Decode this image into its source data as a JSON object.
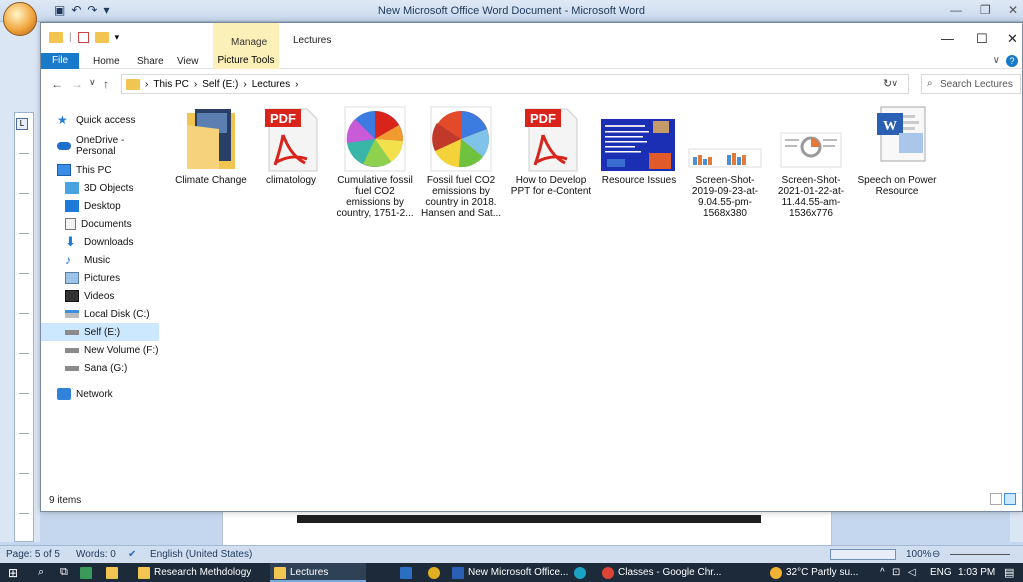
{
  "word": {
    "title": "New Microsoft Office Word Document - Microsoft Word",
    "status": {
      "page": "Page: 5 of 5",
      "words": "Words: 0",
      "language": "English (United States)",
      "zoom": "100%"
    }
  },
  "explorer": {
    "context_tab_group": "Manage",
    "context_title": "Lectures",
    "tabs": [
      "File",
      "Home",
      "Share",
      "View",
      "Picture Tools"
    ],
    "breadcrumb": [
      "This PC",
      "Self (E:)",
      "Lectures"
    ],
    "search_placeholder": "Search Lectures",
    "nav": {
      "quick_access": "Quick access",
      "onedrive": "OneDrive - Personal",
      "this_pc": "This PC",
      "objects3d": "3D Objects",
      "desktop": "Desktop",
      "documents": "Documents",
      "downloads": "Downloads",
      "music": "Music",
      "pictures": "Pictures",
      "videos": "Videos",
      "disk_c": "Local Disk (C:)",
      "self_e": "Self (E:)",
      "volume_f": "New Volume (F:)",
      "sana_g": "Sana (G:)",
      "network": "Network"
    },
    "files": [
      {
        "name": "Climate Change",
        "kind": "folder-icon"
      },
      {
        "name": "climatology",
        "kind": "pdf-icon"
      },
      {
        "name": "Cumulative fossil fuel CO2 emissions by country, 1751-2...",
        "kind": "pie-image-thumbnail"
      },
      {
        "name": "Fossil fuel CO2 emissions by country in 2018. Hansen and Sat...",
        "kind": "pie-image-thumbnail"
      },
      {
        "name": "How to Develop PPT for e-Content",
        "kind": "pdf-icon"
      },
      {
        "name": "Resource Issues",
        "kind": "slide-image-thumbnail"
      },
      {
        "name": "Screen-Shot-2019-09-23-at-9.04.55-pm-1568x380",
        "kind": "screenshot-thumbnail"
      },
      {
        "name": "Screen-Shot-2021-01-22-at-11.44.55-am-1536x776",
        "kind": "screenshot-thumbnail"
      },
      {
        "name": "Speech on Power Resource",
        "kind": "word-document-icon"
      }
    ],
    "pdf_label": "PDF",
    "status": "9 items"
  },
  "taskbar": {
    "items": [
      "Research Methdology",
      "Lectures",
      "New Microsoft Office...",
      "Classes - Google Chr..."
    ],
    "weather": "32°C  Partly su...",
    "lang": "ENG",
    "time": "1:03 PM"
  },
  "colors": {
    "accent": "#1979ca",
    "context_tab": "#fbf1b8",
    "selection": "#cce8ff",
    "folder": "#f2c451",
    "pdf_red": "#d9241c"
  }
}
